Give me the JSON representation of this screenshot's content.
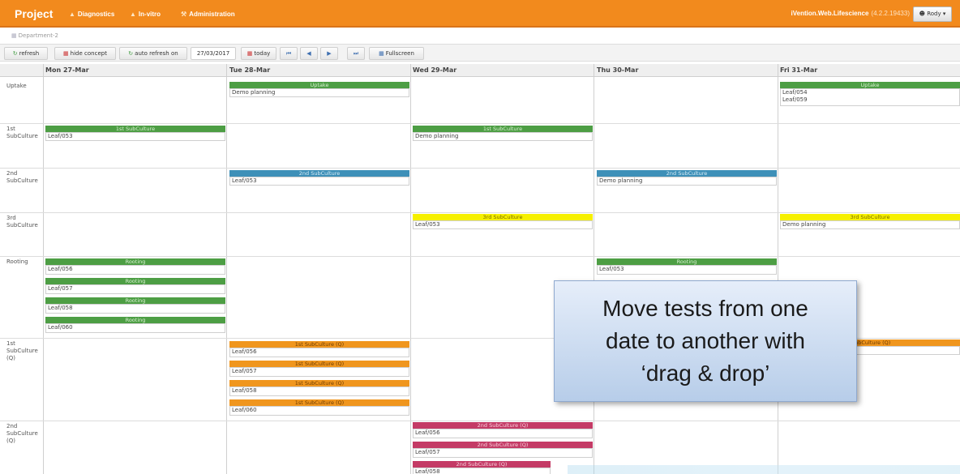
{
  "app": {
    "title": "Project",
    "nav": [
      {
        "label": "Diagnostics",
        "icon": "flask-icon"
      },
      {
        "label": "In-vitro",
        "icon": "flask-icon"
      },
      {
        "label": "Administration",
        "icon": "wrench-icon"
      }
    ],
    "product": "iVention.Web.Lifescience",
    "version": "(4.2.2.19433)",
    "user": "Rody"
  },
  "breadcrumb": "Department-2",
  "toolbar": {
    "refresh": "refresh",
    "hide_concept": "hide concept",
    "auto_refresh": "auto refresh on",
    "date": "27/03/2017",
    "today": "today",
    "fullscreen": "Fullscreen"
  },
  "days": [
    "Mon 27-Mar",
    "Tue 28-Mar",
    "Wed 29-Mar",
    "Thu 30-Mar",
    "Fri 31-Mar"
  ],
  "rows": [
    "Uptake",
    "1st SubCulture",
    "2nd SubCulture",
    "3rd SubCulture",
    "Rooting",
    "1st SubCulture (Q)",
    "2nd SubCulture (Q)"
  ],
  "colors": {
    "green": "#4d9e44",
    "blue": "#3e90b8",
    "yellow": "#f6f000",
    "orange": "#f0961e",
    "crimson": "#c43b66",
    "topbar": "#f28a1d"
  },
  "events": {
    "uptake_tue": {
      "label": "Uptake",
      "items": [
        "Demo planning"
      ]
    },
    "uptake_fri": {
      "label": "Uptake",
      "items": [
        "Leaf/054",
        "Leaf/059"
      ]
    },
    "sub1_mon": {
      "label": "1st SubCulture",
      "items": [
        "Leaf/053"
      ]
    },
    "sub1_wed": {
      "label": "1st SubCulture",
      "items": [
        "Demo planning"
      ]
    },
    "sub2_tue": {
      "label": "2nd SubCulture",
      "items": [
        "Leaf/053"
      ]
    },
    "sub2_thu": {
      "label": "2nd SubCulture",
      "items": [
        "Demo planning"
      ]
    },
    "sub3_wed": {
      "label": "3rd SubCulture",
      "items": [
        "Leaf/053"
      ]
    },
    "sub3_fri": {
      "label": "3rd SubCulture",
      "items": [
        "Demo planning"
      ]
    },
    "root_mon": [
      {
        "label": "Rooting",
        "items": [
          "Leaf/056"
        ]
      },
      {
        "label": "Rooting",
        "items": [
          "Leaf/057"
        ]
      },
      {
        "label": "Rooting",
        "items": [
          "Leaf/058"
        ]
      },
      {
        "label": "Rooting",
        "items": [
          "Leaf/060"
        ]
      }
    ],
    "root_thu": {
      "label": "Rooting",
      "items": [
        "Leaf/053"
      ]
    },
    "sub1q_tue": [
      {
        "label": "1st SubCulture (Q)",
        "items": [
          "Leaf/056"
        ]
      },
      {
        "label": "1st SubCulture (Q)",
        "items": [
          "Leaf/057"
        ]
      },
      {
        "label": "1st SubCulture (Q)",
        "items": [
          "Leaf/058"
        ]
      },
      {
        "label": "1st SubCulture (Q)",
        "items": [
          "Leaf/060"
        ]
      }
    ],
    "sub1q_fri": {
      "label": "SubCulture (Q)"
    },
    "sub2q_wed": [
      {
        "label": "2nd SubCulture (Q)",
        "items": [
          "Leaf/056"
        ]
      },
      {
        "label": "2nd SubCulture (Q)",
        "items": [
          "Leaf/057"
        ]
      },
      {
        "label": "2nd SubCulture (Q)",
        "items": [
          "Leaf/058"
        ]
      }
    ]
  },
  "callout": {
    "lines": [
      "Move tests from one",
      "date to another with",
      "‘drag & drop’"
    ]
  }
}
